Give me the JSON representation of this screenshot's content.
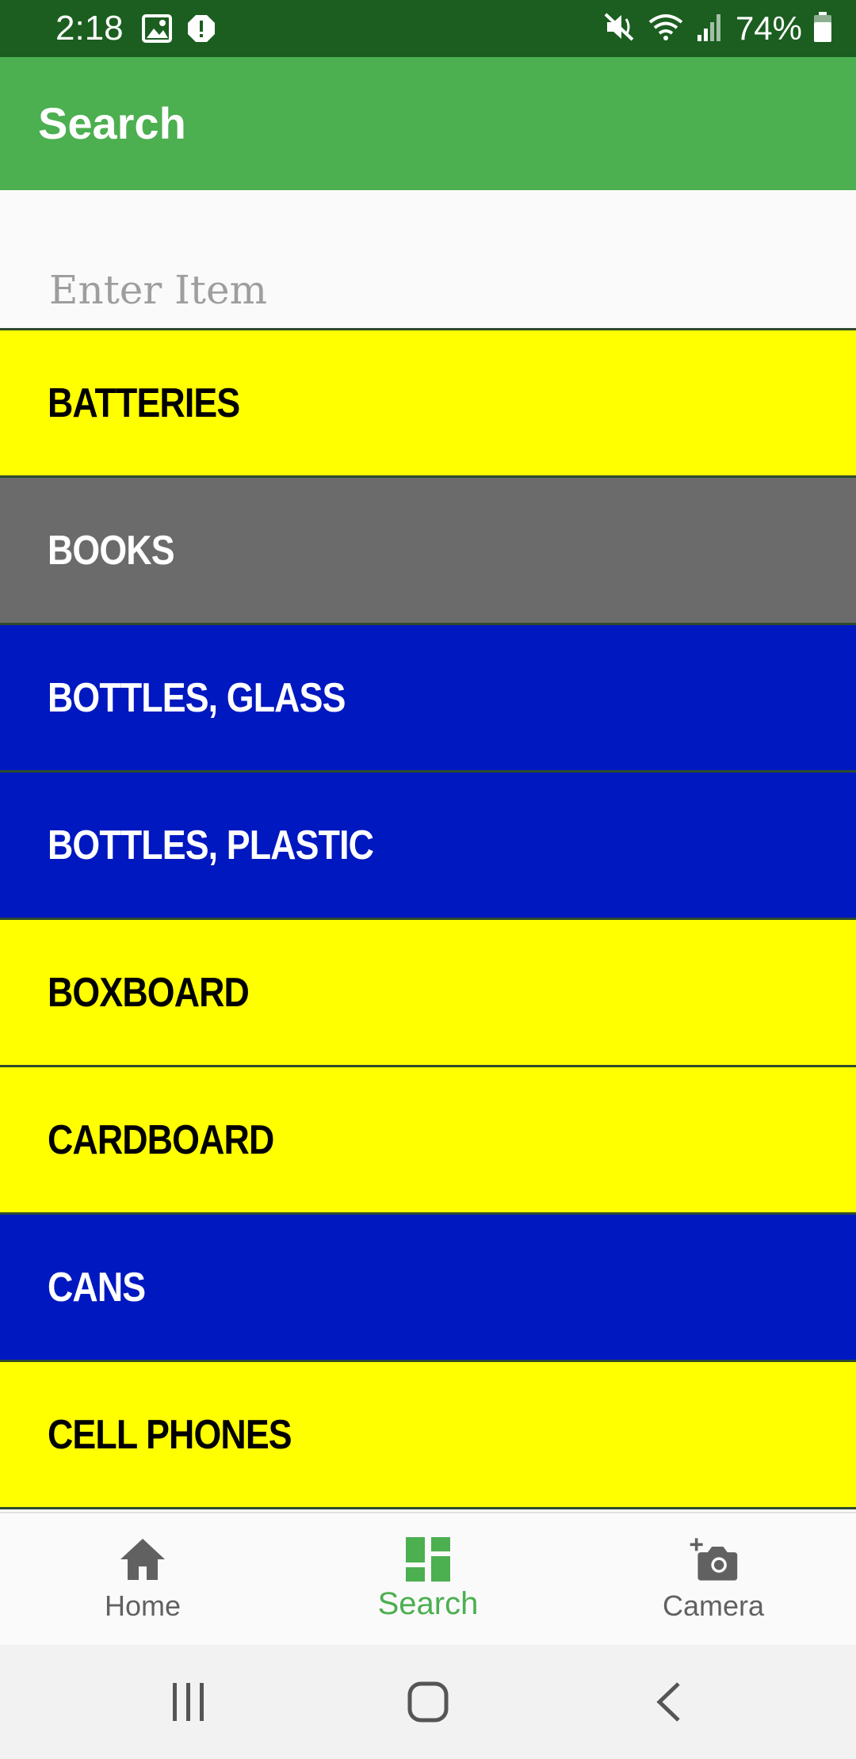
{
  "status_bar": {
    "time": "2:18",
    "battery": "74%",
    "icons": [
      "image-icon",
      "alert-icon",
      "mute-icon",
      "wifi-icon",
      "signal-icon",
      "battery-icon"
    ]
  },
  "app_bar": {
    "title": "Search"
  },
  "search": {
    "placeholder": "Enter Item",
    "value": ""
  },
  "items": [
    {
      "label": "BATTERIES",
      "bg": "#ffff00",
      "fg": "#000000"
    },
    {
      "label": "BOOKS",
      "bg": "#6b6b6b",
      "fg": "#ffffff"
    },
    {
      "label": "BOTTLES, GLASS",
      "bg": "#0018c0",
      "fg": "#ffffff"
    },
    {
      "label": "BOTTLES, PLASTIC",
      "bg": "#0018c0",
      "fg": "#ffffff"
    },
    {
      "label": "BOXBOARD",
      "bg": "#ffff00",
      "fg": "#000000"
    },
    {
      "label": "CARDBOARD",
      "bg": "#ffff00",
      "fg": "#000000"
    },
    {
      "label": "CANS",
      "bg": "#0018c0",
      "fg": "#ffffff"
    },
    {
      "label": "CELL PHONES",
      "bg": "#ffff00",
      "fg": "#000000"
    }
  ],
  "bottom_nav": [
    {
      "label": "Home",
      "icon": "home-icon",
      "active": false
    },
    {
      "label": "Search",
      "icon": "dashboard-icon",
      "active": true
    },
    {
      "label": "Camera",
      "icon": "add-camera-icon",
      "active": false
    }
  ],
  "colors": {
    "status_bar": "#1b5e20",
    "app_bar": "#4caf50",
    "accent": "#4caf50",
    "inactive": "#616161"
  }
}
